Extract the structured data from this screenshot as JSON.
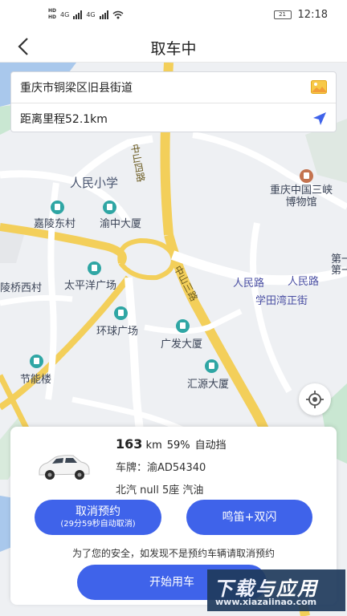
{
  "status_bar": {
    "time": "12:18",
    "battery": "21",
    "left_labels": [
      "HD",
      "4G",
      "4G"
    ]
  },
  "nav": {
    "title": "取车中"
  },
  "address_card": {
    "address": "重庆市铜梁区旧县街道",
    "distance": "距离里程52.1km"
  },
  "map": {
    "places": [
      "人民小学",
      "嘉陵东村",
      "渝中大厦",
      "太平洋广场",
      "环球广场",
      "广发大厦",
      "节能楼",
      "汇源大厦",
      "重庆中国三峡博物馆",
      "学田湾正街",
      "陵桥西村"
    ],
    "roads": [
      "中山四路",
      "中山三路",
      "人民路",
      "人民路",
      "第一",
      "第一"
    ]
  },
  "vehicle": {
    "mileage": "163",
    "mileage_unit": "km",
    "battery_level": "59%",
    "transmission": "自动挡",
    "plate": "车牌：渝AD54340",
    "model": "北汽 null 5座 汽油"
  },
  "actions": {
    "cancel_label": "取消预约",
    "cancel_countdown": "(29分59秒自动取消)",
    "honk_label": "鸣笛+双闪",
    "safety_note": "为了您的安全，如发现不是预约车辆请取消预约",
    "start_label": "开始用车"
  },
  "watermark": {
    "main": "下载与应用",
    "sub": "www.xiazaiinao.com"
  },
  "colors": {
    "primary": "#3f63ea",
    "major_road": "#f3cf5a",
    "water": "#a9c8ec",
    "map_bg": "#eef0f3"
  },
  "icons": [
    "back-icon",
    "image-icon",
    "locate-arrow-icon",
    "gps-target-icon",
    "car-image"
  ]
}
